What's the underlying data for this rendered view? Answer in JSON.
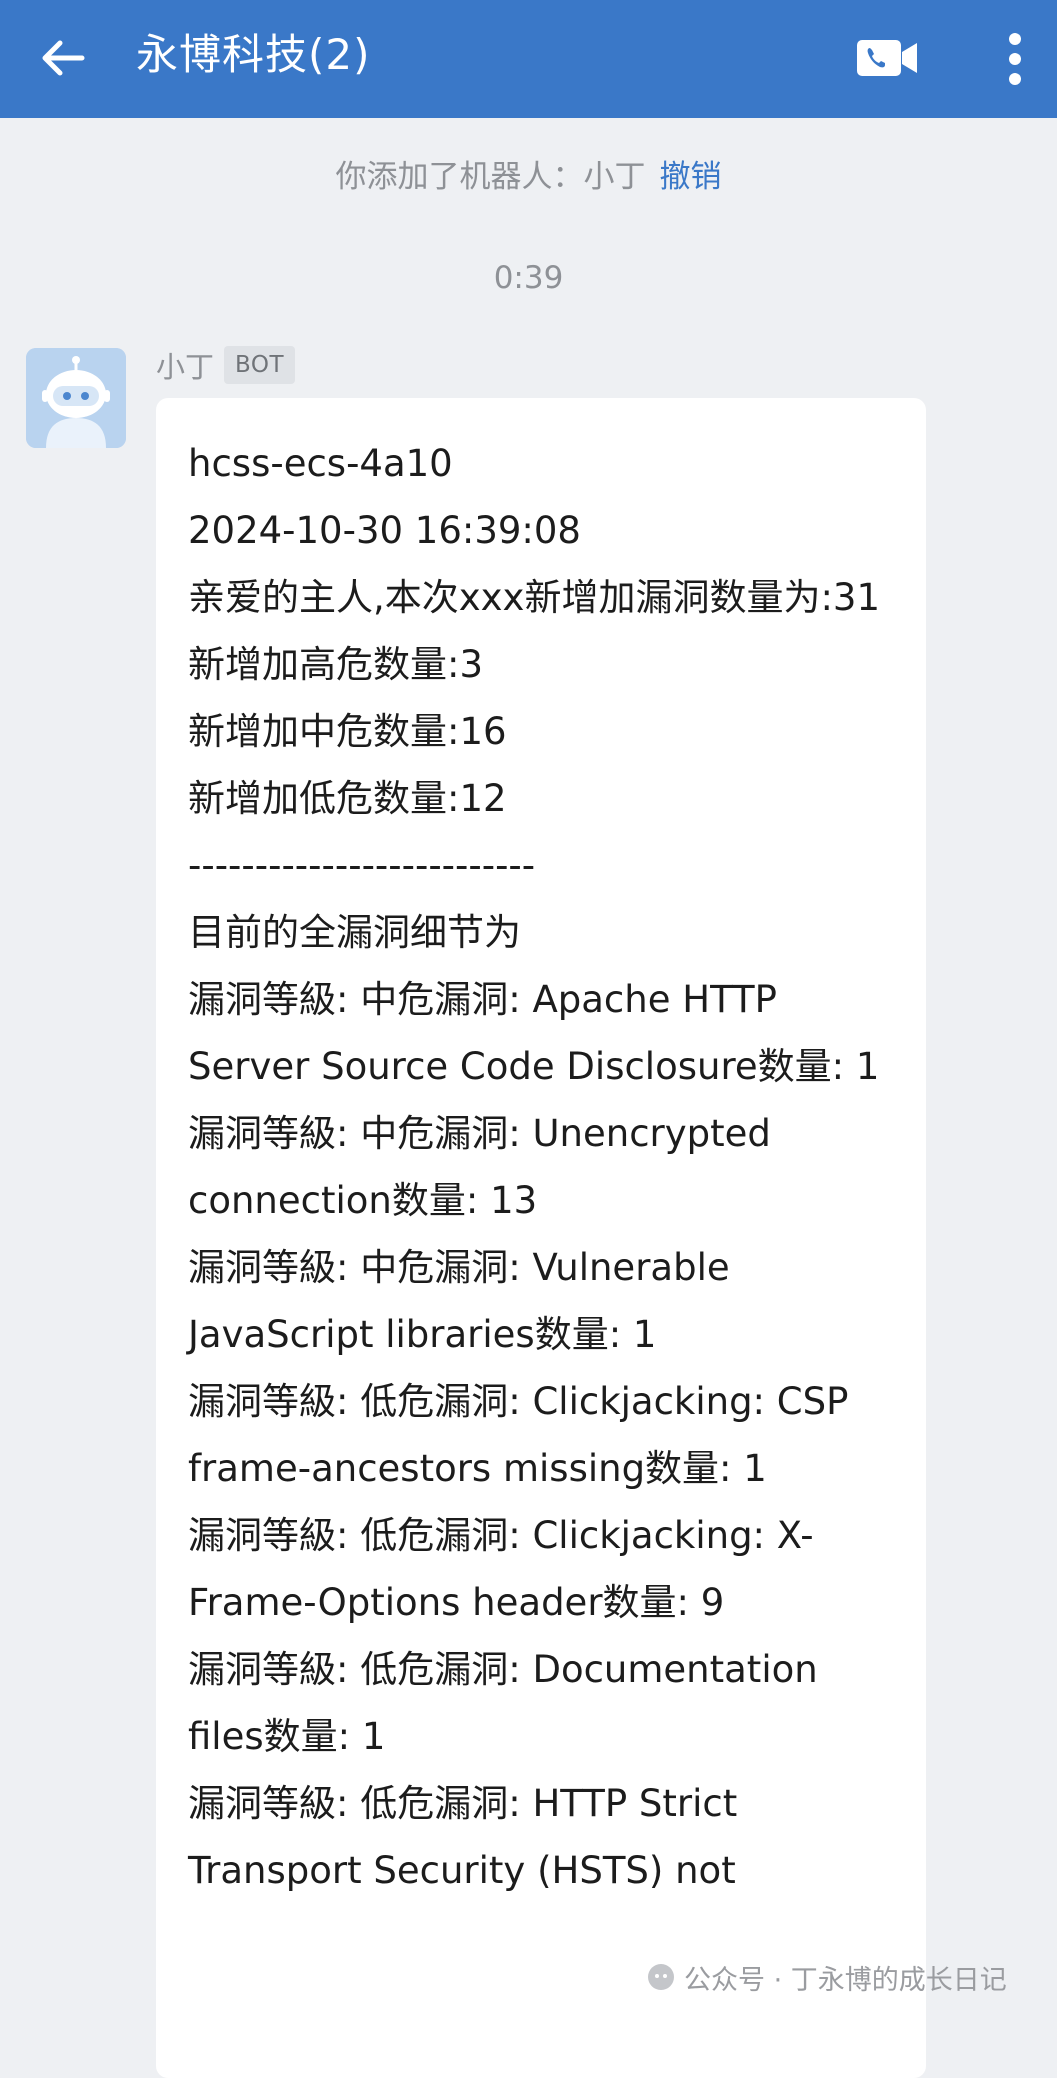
{
  "header": {
    "title": "永博科技(2)",
    "back_icon": "arrow-left-icon",
    "video_icon": "video-call-icon",
    "more_icon": "more-vertical-icon",
    "color": "#3a78c8"
  },
  "system_notice": {
    "text": "你添加了机器人：小丁",
    "undo_label": "撤销"
  },
  "timestamp": "0:39",
  "message": {
    "sender_name": "小丁",
    "sender_badge": "BOT",
    "avatar_icon": "robot-avatar-icon",
    "lines": [
      "hcss-ecs-4a10",
      "2024-10-30 16:39:08",
      "亲爱的主人,本次xxx新增加漏洞数量为:31",
      "新增加高危数量:3",
      "新增加中危数量:16",
      "新增加低危数量:12",
      "--------------------------",
      "目前的全漏洞细节为",
      "漏洞等級: 中危漏洞: Apache HTTP Server Source Code Disclosure数量: 1",
      "漏洞等級: 中危漏洞: Unencrypted connection数量: 13",
      "漏洞等級: 中危漏洞: Vulnerable JavaScript libraries数量: 1",
      "漏洞等級: 低危漏洞: Clickjacking: CSP frame-ancestors missing数量: 1",
      "漏洞等級: 低危漏洞: Clickjacking: X-Frame-Options header数量: 9",
      "漏洞等級: 低危漏洞: Documentation files数量: 1",
      "漏洞等級: 低危漏洞: HTTP Strict Transport Security (HSTS) not"
    ]
  },
  "watermark": {
    "text": "公众号 · 丁永博的成长日记",
    "icon": "wechat-official-icon"
  }
}
